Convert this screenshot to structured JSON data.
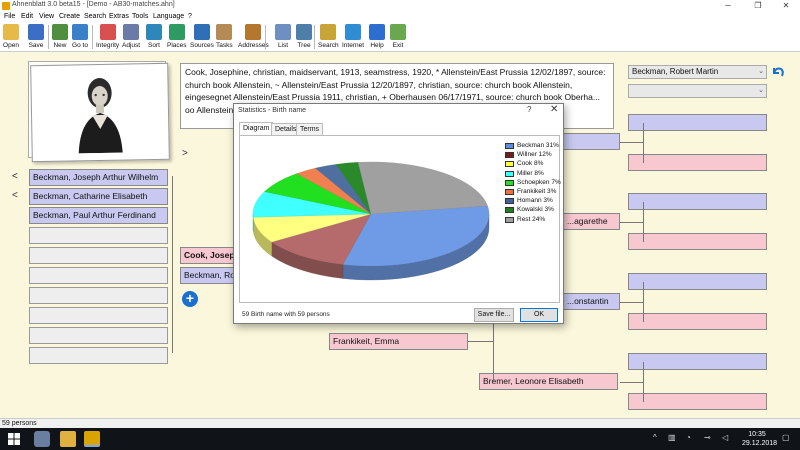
{
  "window": {
    "title": "Ahnenblatt 3.0 beta15 - [Demo - AB30-matches.ahn]",
    "controls": [
      "─",
      "❐",
      "✕"
    ]
  },
  "menu": [
    "File",
    "Edit",
    "View",
    "Create",
    "Search",
    "Extras",
    "Tools",
    "Language",
    "?"
  ],
  "toolbar": [
    {
      "label": "Open",
      "icon": "folder-open-icon",
      "color": "#e7b84a"
    },
    {
      "label": "Save",
      "icon": "floppy-disk-icon",
      "color": "#3b6fc4"
    },
    {
      "label": "New",
      "icon": "new-person-icon",
      "color": "#4f8f3f"
    },
    {
      "label": "Go to",
      "icon": "go-to-person-icon",
      "color": "#3c7fc9"
    },
    {
      "label": "Integrity",
      "icon": "integrity-check-icon",
      "color": "#d85050"
    },
    {
      "label": "Adjust",
      "icon": "adjust-icon",
      "color": "#6c7aa8"
    },
    {
      "label": "Sort",
      "icon": "sort-icon",
      "color": "#2f86b8"
    },
    {
      "label": "Places",
      "icon": "globe-icon",
      "color": "#2f9b63"
    },
    {
      "label": "Sources",
      "icon": "sources-icon",
      "color": "#2e6fb8"
    },
    {
      "label": "Tasks",
      "icon": "tasks-clipboard-icon",
      "color": "#b48a56"
    },
    {
      "label": "Addresses",
      "icon": "address-book-icon",
      "color": "#b5762e"
    },
    {
      "label": "List",
      "icon": "list-icon",
      "color": "#6d8fc2"
    },
    {
      "label": "Tree",
      "icon": "tree-icon",
      "color": "#4e7fa8"
    },
    {
      "label": "Search",
      "icon": "magnifier-icon",
      "color": "#c9a537"
    },
    {
      "label": "Internet",
      "icon": "internet-globe-icon",
      "color": "#2f8dd6"
    },
    {
      "label": "Help",
      "icon": "help-icon",
      "color": "#2d6fd0"
    },
    {
      "label": "Exit",
      "icon": "exit-icon",
      "color": "#6aa84f"
    }
  ],
  "notes": {
    "text": "Cook, Josephine, christian, maidservant, 1913, seamstress, 1920, * Allenstein/East Prussia 12/02/1897, source: church book Allenstein, ~ Allenstein/East Prussia 12/20/1897, christian, source: church book Allenstein, eingesegnet Allenstein/East Prussia 1911, christian, + Oberhausen 06/17/1971, source: church book Oberha... oo Allenstein... traße 72"
  },
  "left_nav": {
    "prev_arrow": "<",
    "next_arrow": ">",
    "children": [
      "Beckman, Joseph Arthur Wilhelm",
      "Beckman, Catharine Elisabeth",
      "Beckman, Paul Arthur Ferdinand",
      "",
      "",
      "",
      "",
      "",
      "",
      ""
    ],
    "center_person": "Cook, Joseph",
    "spouse": "Beckman, Ro"
  },
  "right_panel": {
    "combo_value": "Beckman, Robert Martin",
    "back_icon": "undo-arrow-icon"
  },
  "tree_boxes": {
    "partial_garethe": "...agarethe",
    "partial_konstantin": "...onstantin",
    "frankikeit": "Frankikeit, Emma",
    "bremer": "Bremer, Leonore Elisabeth"
  },
  "status": "59 persons",
  "taskbar": {
    "time": "10:35",
    "date": "29.12.2018"
  },
  "dialog": {
    "title": "Statistics - Birth name",
    "help": "?",
    "close": "✕",
    "tabs": [
      "Diagram",
      "Details",
      "Terms"
    ],
    "footer": "59 Birth name with 59 persons",
    "save_label": "Save file...",
    "ok_label": "OK"
  },
  "chart_data": {
    "type": "pie",
    "title": "",
    "slices": [
      {
        "label": "Beckman 31%",
        "value": 31,
        "color": "#6f9be6"
      },
      {
        "label": "Willner 12%",
        "value": 12,
        "color": "#b56b6b"
      },
      {
        "label": "Cook 8%",
        "value": 8,
        "color": "#ffff80"
      },
      {
        "label": "Miller 8%",
        "value": 8,
        "color": "#40ffff"
      },
      {
        "label": "Schoepken 7%",
        "value": 7,
        "color": "#20e020"
      },
      {
        "label": "Frankikeit 3%",
        "value": 3,
        "color": "#f08050"
      },
      {
        "label": "Homann 3%",
        "value": 3,
        "color": "#4f6fa0"
      },
      {
        "label": "Kowalski 3%",
        "value": 3,
        "color": "#2a8a2a"
      },
      {
        "label": "Rest 24%",
        "value": 24,
        "color": "#a0a0a0"
      }
    ],
    "legend_swatches": [
      "#5b8de0",
      "#7a1a1a",
      "#ffff40",
      "#40ffff",
      "#20e020",
      "#f07040",
      "#4060a0",
      "#208020",
      "#a0a0a0"
    ],
    "legend_position": "right"
  }
}
